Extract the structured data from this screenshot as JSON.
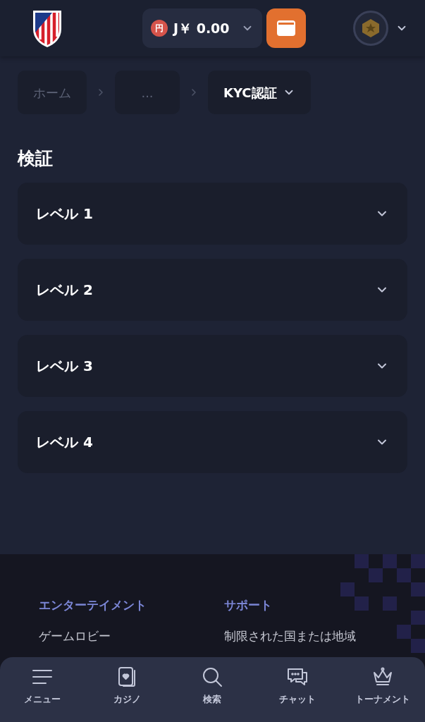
{
  "header": {
    "currency_symbol": "円",
    "balance": "J￥ 0.00"
  },
  "breadcrumbs": [
    {
      "label": "ホーム",
      "selected": false
    },
    {
      "label": "...",
      "selected": false
    },
    {
      "label": "KYC認証",
      "selected": true
    }
  ],
  "title": "検証",
  "levels": [
    {
      "label": "レベル 1",
      "expanded": false
    },
    {
      "label": "レベル 2",
      "expanded": false
    },
    {
      "label": "レベル 3",
      "expanded": false
    },
    {
      "label": "レベル 4",
      "expanded": false
    }
  ],
  "footer": {
    "columns": [
      {
        "heading": "エンターテイメント",
        "links": [
          "ゲームロビー"
        ]
      },
      {
        "heading": "サポート",
        "links": [
          "制限された国または地域"
        ]
      }
    ]
  },
  "bottom_nav": [
    {
      "kind": "menu",
      "label": "メニュー"
    },
    {
      "kind": "casino",
      "label": "カジノ"
    },
    {
      "kind": "search",
      "label": "検索"
    },
    {
      "kind": "chat",
      "label": "チャット"
    },
    {
      "kind": "tournament",
      "label": "トーナメント"
    }
  ]
}
